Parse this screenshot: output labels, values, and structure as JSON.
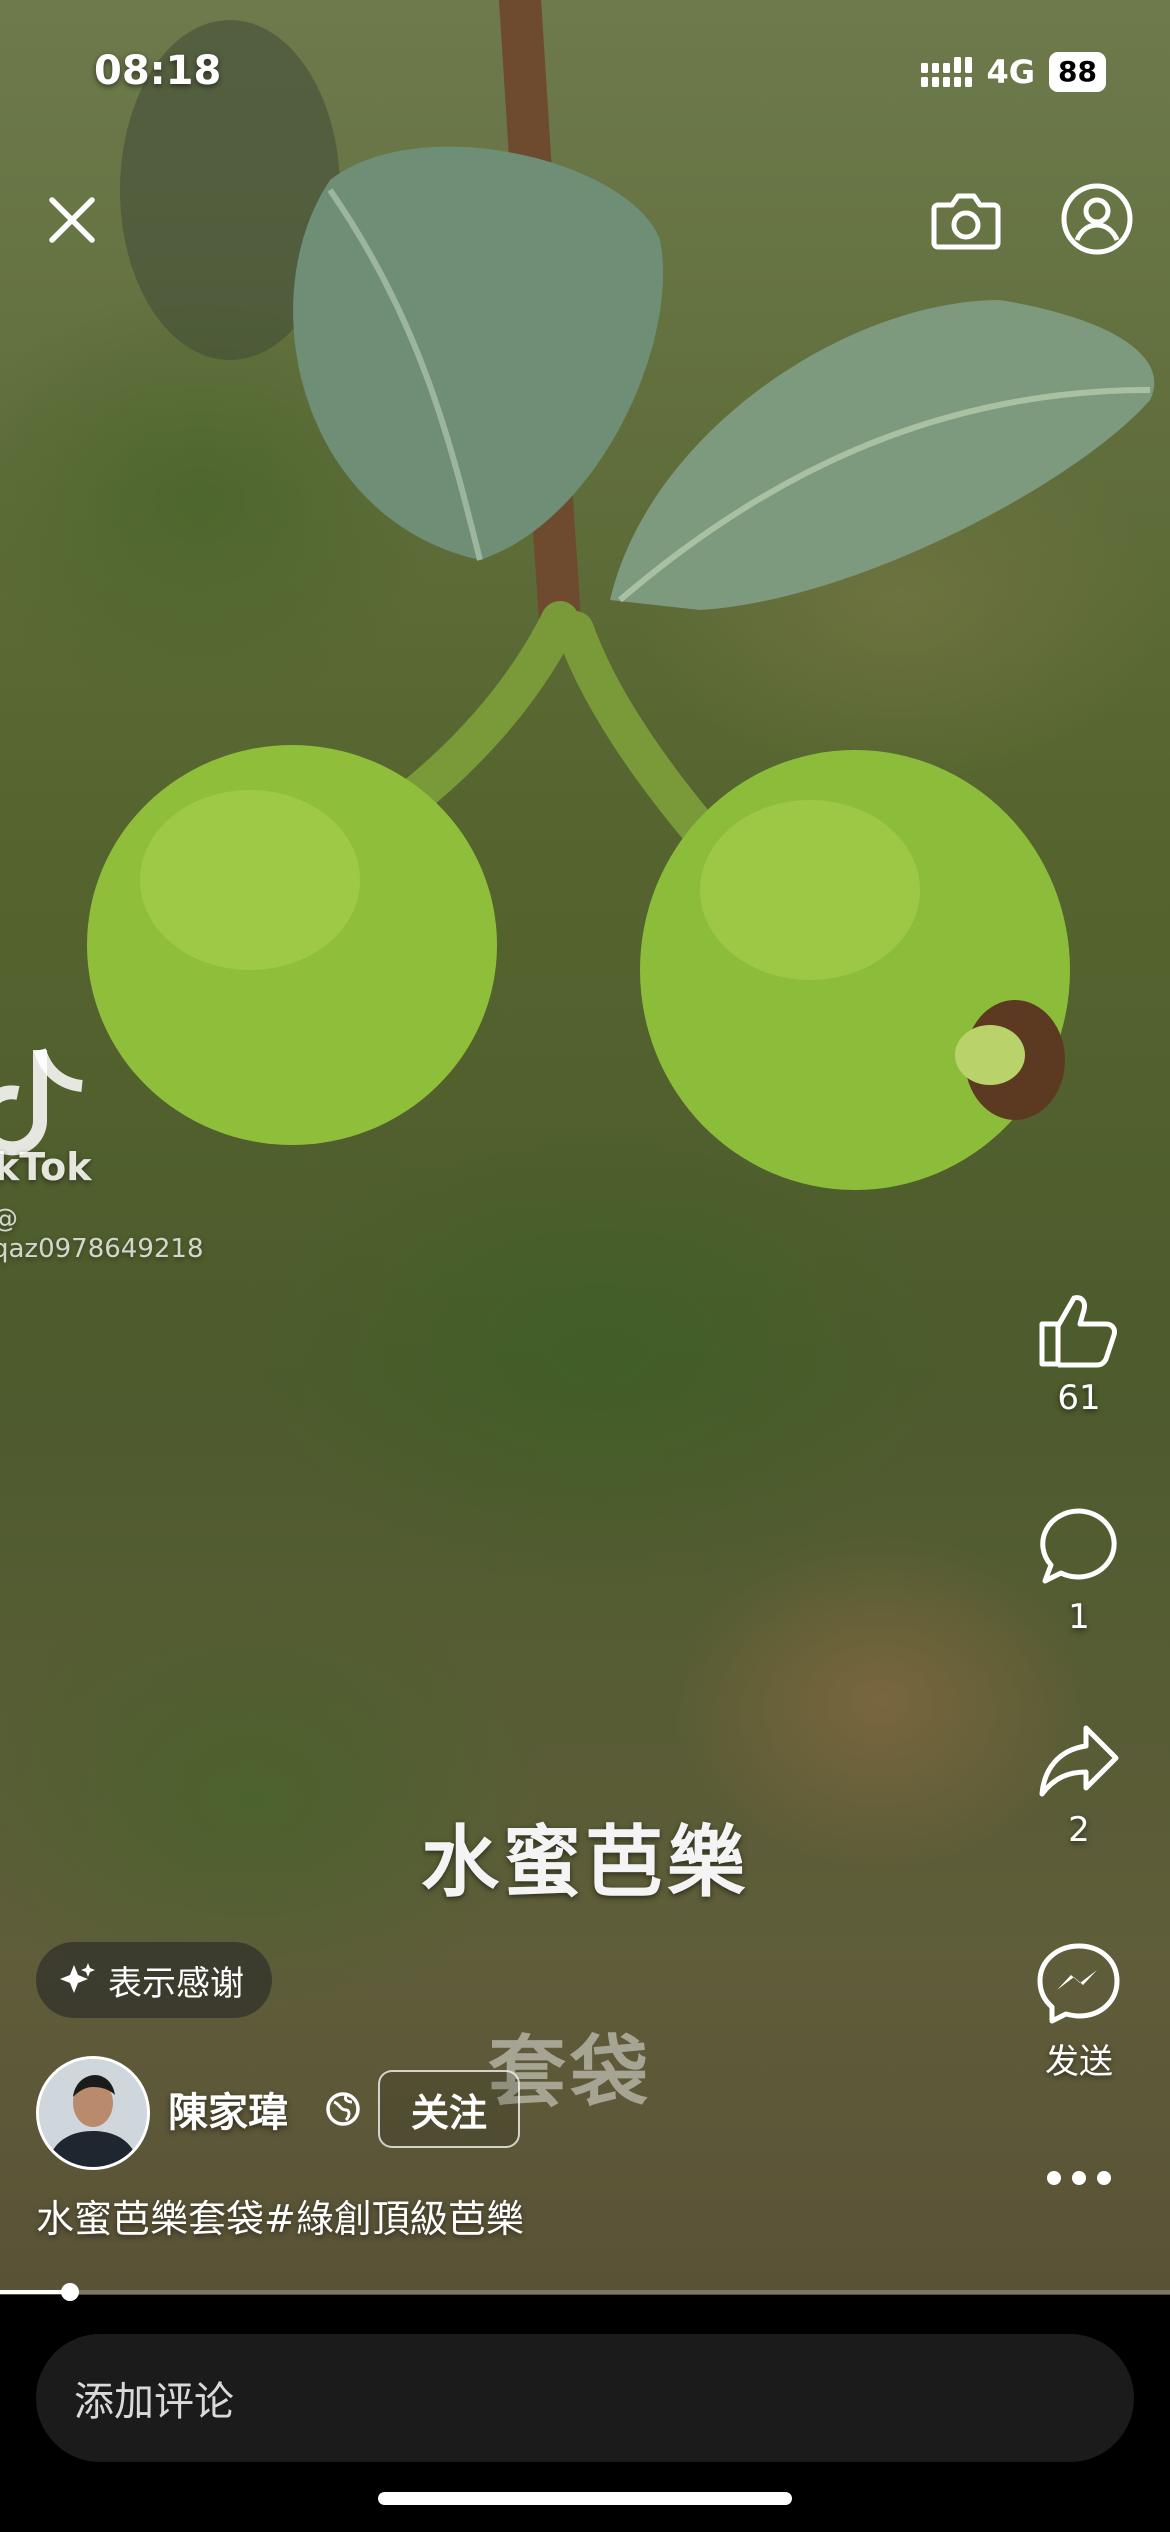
{
  "status_bar": {
    "time": "08:18",
    "network": "4G",
    "battery": "88"
  },
  "watermark": {
    "brand": "kTok",
    "user": "@ qaz0978649218"
  },
  "actions": {
    "like_count": "61",
    "comment_count": "1",
    "share_count": "2",
    "send_label": "发送"
  },
  "overlay": {
    "title": "水蜜芭樂",
    "subtitle": "套袋"
  },
  "thanks_label": "表示感谢",
  "author": {
    "name": "陳家瑋",
    "follow_label": "关注"
  },
  "caption": "水蜜芭樂套袋#綠創頂級芭樂",
  "playback": {
    "progress": 0.06
  },
  "comment_placeholder": "添加评论",
  "icons": [
    "close-icon",
    "camera-icon",
    "profile-icon",
    "like-icon",
    "comment-icon",
    "share-icon",
    "messenger-icon",
    "more-icon",
    "sparkle-icon",
    "globe-icon",
    "tiktok-logo-icon"
  ]
}
